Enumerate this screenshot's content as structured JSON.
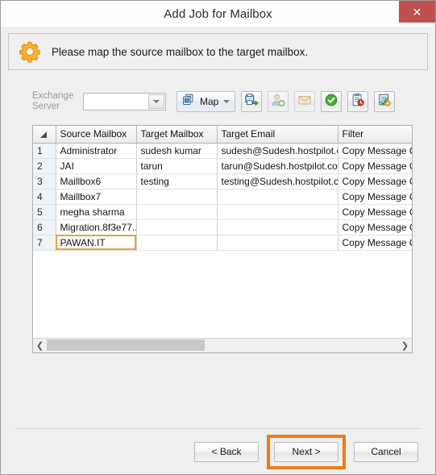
{
  "window": {
    "title": "Add Job for Mailbox",
    "close_label": "✕"
  },
  "banner": {
    "icon": "gear-icon",
    "message": "Please map the source mailbox to the target mailbox."
  },
  "toolbar": {
    "exchange_label_line1": "Exchange",
    "exchange_label_line2": "Server",
    "exchange_value": "",
    "exchange_placeholder": "",
    "map_button_label": "Map",
    "buttons": [
      {
        "name": "export-icon",
        "enabled": true
      },
      {
        "name": "add-user-icon",
        "enabled": false
      },
      {
        "name": "mail-icon",
        "enabled": false
      },
      {
        "name": "check-circle-icon",
        "enabled": true
      },
      {
        "name": "report-clock-icon",
        "enabled": true
      },
      {
        "name": "validate-settings-icon",
        "enabled": true
      }
    ]
  },
  "grid": {
    "columns": [
      "Source Mailbox",
      "Target Mailbox",
      "Target Email",
      "Filter"
    ],
    "rows": [
      {
        "num": "1",
        "source": "Administrator",
        "target": "sudesh kumar",
        "email": "sudesh@Sudesh.hostpilot.c...",
        "filter": "Copy Message C"
      },
      {
        "num": "2",
        "source": "JAI",
        "target": "tarun",
        "email": "tarun@Sudesh.hostpilot.com",
        "filter": "Copy Message C"
      },
      {
        "num": "3",
        "source": "Maillbox6",
        "target": "testing",
        "email": "testing@Sudesh.hostpilot.com",
        "filter": "Copy Message C"
      },
      {
        "num": "4",
        "source": "Maillbox7",
        "target": "",
        "email": "",
        "filter": "Copy Message C"
      },
      {
        "num": "5",
        "source": "megha sharma",
        "target": "",
        "email": "",
        "filter": "Copy Message C"
      },
      {
        "num": "6",
        "source": "Migration.8f3e77...",
        "target": "",
        "email": "",
        "filter": "Copy Message C"
      },
      {
        "num": "7",
        "source": "PAWAN.IT",
        "target": "",
        "email": "",
        "filter": "Copy Message C"
      }
    ],
    "selected_row_index": 6,
    "selected_column": "source",
    "hscroll_left_arrow": "❮",
    "hscroll_right_arrow": "❯",
    "hscroll_thumb_percent": 45
  },
  "footer": {
    "back_label": "< Back",
    "next_label": "Next >",
    "cancel_label": "Cancel",
    "highlighted_button": "Next >"
  },
  "colors": {
    "close_button": "#c0504d",
    "highlight": "#f07c16",
    "selection_outline": "#e8a33d",
    "gear": "#f5a623",
    "window_background": "#efefef"
  }
}
